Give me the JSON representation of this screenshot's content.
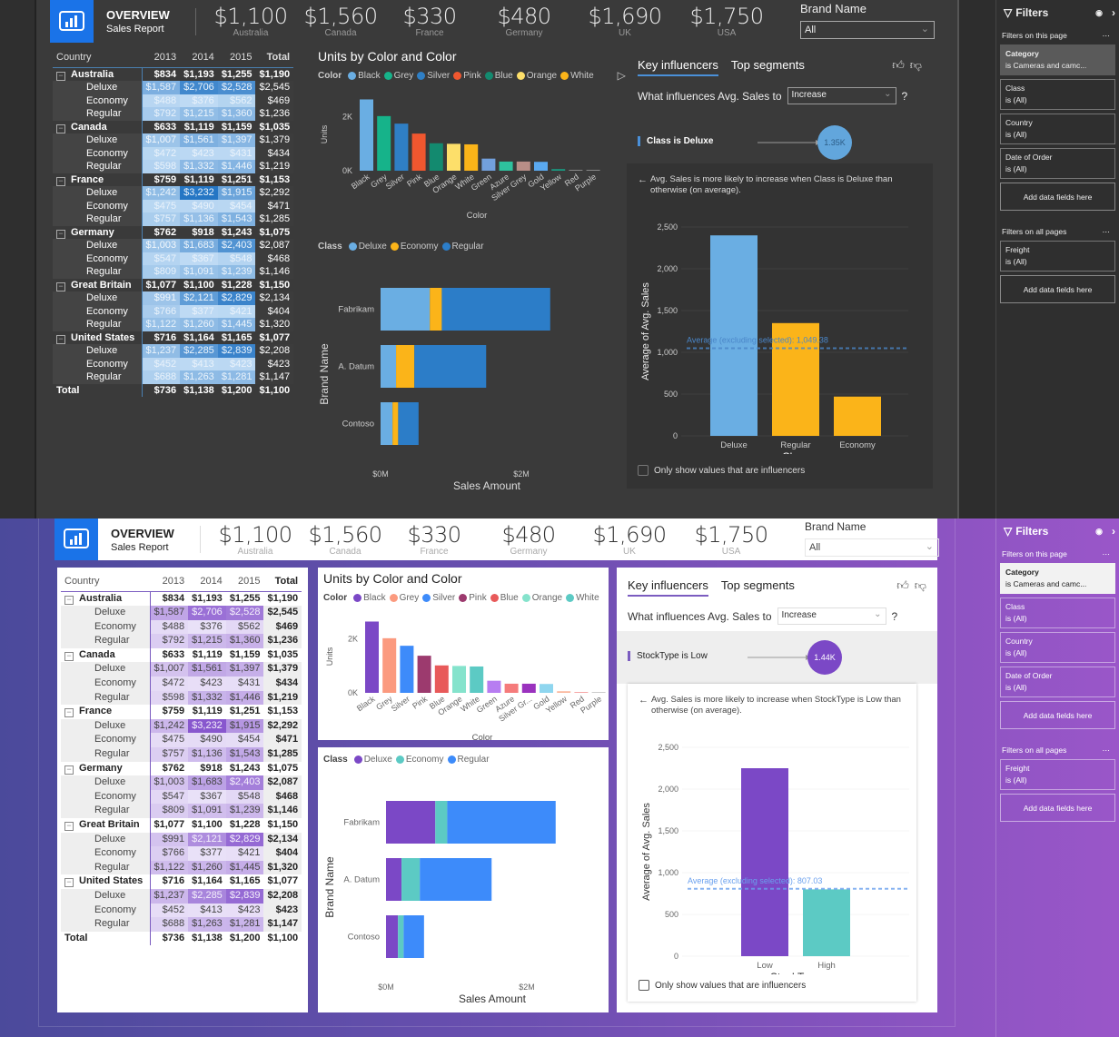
{
  "themes": [
    {
      "id": "dark",
      "header": {
        "title": "OVERVIEW",
        "subtitle": "Sales Report",
        "kpis": [
          {
            "value": "$1,100",
            "label": "Australia"
          },
          {
            "value": "$1,560",
            "label": "Canada"
          },
          {
            "value": "$330",
            "label": "France"
          },
          {
            "value": "$480",
            "label": "Germany"
          },
          {
            "value": "$1,690",
            "label": "UK"
          },
          {
            "value": "$1,750",
            "label": "USA"
          }
        ],
        "slicer": {
          "label": "Brand Name",
          "value": "All"
        }
      },
      "colors": {
        "units_bars": [
          "#6aaee3",
          "#16b38a",
          "#2f7fc5",
          "#f0572f",
          "#138a6f",
          "#fddf6a",
          "#fbb419",
          "#72a0dd",
          "#2ec29e",
          "#b88e87",
          "#5aa9f0",
          "#1a9b82",
          "#888888",
          "#888888"
        ],
        "class": {
          "Deluxe": "#6aaee3",
          "Economy": "#fbb419",
          "Regular": "#2c7dc8"
        },
        "ki_bars": [
          "#6aaee3",
          "#fbb419",
          "#fbb419"
        ],
        "ki_avg_line": "#4a86c8",
        "heat_low": [
          191,
          219,
          244
        ],
        "heat_high": [
          36,
          117,
          196
        ]
      },
      "key_influencers": {
        "factor": "Class is Deluxe",
        "bubble": "1.35K",
        "description": "Avg. Sales is more likely to increase when Class is Deluxe than otherwise (on average).",
        "xlabel": "Class",
        "categories": [
          "Deluxe",
          "Regular",
          "Economy"
        ],
        "values": [
          2400,
          1350,
          470
        ],
        "average_label": "Average (excluding selected): 1,049.38",
        "average": 1049.38
      }
    },
    {
      "id": "light",
      "header": {
        "title": "OVERVIEW",
        "subtitle": "Sales Report",
        "kpis": [
          {
            "value": "$1,100",
            "label": "Australia"
          },
          {
            "value": "$1,560",
            "label": "Canada"
          },
          {
            "value": "$330",
            "label": "France"
          },
          {
            "value": "$480",
            "label": "Germany"
          },
          {
            "value": "$1,690",
            "label": "UK"
          },
          {
            "value": "$1,750",
            "label": "USA"
          }
        ],
        "slicer": {
          "label": "Brand Name",
          "value": "All"
        }
      },
      "colors": {
        "units_bars": [
          "#7b48c6",
          "#fb9a7f",
          "#3d8bfa",
          "#9c3a6e",
          "#e85a5a",
          "#85e3cc",
          "#5ccac4",
          "#b77df1",
          "#f57b7b",
          "#9a32be",
          "#8fd6ef",
          "#fbb99f",
          "#f6a6a6",
          "#cccccc"
        ],
        "class": {
          "Deluxe": "#7b48c6",
          "Economy": "#5ccac4",
          "Regular": "#3d8bfa"
        },
        "ki_bars": [
          "#7b48c6",
          "#5ccac4"
        ],
        "ki_avg_line": "#6aa0ee",
        "heat_low": [
          234,
          226,
          248
        ],
        "heat_high": [
          135,
          86,
          206
        ]
      },
      "key_influencers": {
        "factor": "StockType is Low",
        "bubble": "1.44K",
        "description": "Avg. Sales is more likely to increase when StockType is Low than otherwise (on average).",
        "xlabel": "StockType",
        "categories": [
          "Low",
          "High"
        ],
        "values": [
          2250,
          800
        ],
        "average_label": "Average (excluding selected): 807.03",
        "average": 807.03
      }
    }
  ],
  "matrix": {
    "headers": [
      "Country",
      "2013",
      "2014",
      "2015",
      "Total"
    ],
    "rows": [
      {
        "type": "country",
        "name": "Australia",
        "v": [
          "$834",
          "$1,193",
          "$1,255",
          "$1,190"
        ]
      },
      {
        "type": "sub",
        "name": "Deluxe",
        "v": [
          "$1,587",
          "$2,706",
          "$2,528",
          "$2,545"
        ],
        "n": [
          1587,
          2706,
          2528
        ]
      },
      {
        "type": "sub",
        "name": "Economy",
        "v": [
          "$488",
          "$376",
          "$562",
          "$469"
        ],
        "n": [
          488,
          376,
          562
        ]
      },
      {
        "type": "sub",
        "name": "Regular",
        "v": [
          "$792",
          "$1,215",
          "$1,360",
          "$1,236"
        ],
        "n": [
          792,
          1215,
          1360
        ]
      },
      {
        "type": "country",
        "name": "Canada",
        "v": [
          "$633",
          "$1,119",
          "$1,159",
          "$1,035"
        ]
      },
      {
        "type": "sub",
        "name": "Deluxe",
        "v": [
          "$1,007",
          "$1,561",
          "$1,397",
          "$1,379"
        ],
        "n": [
          1007,
          1561,
          1397
        ]
      },
      {
        "type": "sub",
        "name": "Economy",
        "v": [
          "$472",
          "$423",
          "$431",
          "$434"
        ],
        "n": [
          472,
          423,
          431
        ]
      },
      {
        "type": "sub",
        "name": "Regular",
        "v": [
          "$598",
          "$1,332",
          "$1,446",
          "$1,219"
        ],
        "n": [
          598,
          1332,
          1446
        ]
      },
      {
        "type": "country",
        "name": "France",
        "v": [
          "$759",
          "$1,119",
          "$1,251",
          "$1,153"
        ]
      },
      {
        "type": "sub",
        "name": "Deluxe",
        "v": [
          "$1,242",
          "$3,232",
          "$1,915",
          "$2,292"
        ],
        "n": [
          1242,
          3232,
          1915
        ]
      },
      {
        "type": "sub",
        "name": "Economy",
        "v": [
          "$475",
          "$490",
          "$454",
          "$471"
        ],
        "n": [
          475,
          490,
          454
        ]
      },
      {
        "type": "sub",
        "name": "Regular",
        "v": [
          "$757",
          "$1,136",
          "$1,543",
          "$1,285"
        ],
        "n": [
          757,
          1136,
          1543
        ]
      },
      {
        "type": "country",
        "name": "Germany",
        "v": [
          "$762",
          "$918",
          "$1,243",
          "$1,075"
        ]
      },
      {
        "type": "sub",
        "name": "Deluxe",
        "v": [
          "$1,003",
          "$1,683",
          "$2,403",
          "$2,087"
        ],
        "n": [
          1003,
          1683,
          2403
        ]
      },
      {
        "type": "sub",
        "name": "Economy",
        "v": [
          "$547",
          "$367",
          "$548",
          "$468"
        ],
        "n": [
          547,
          367,
          548
        ]
      },
      {
        "type": "sub",
        "name": "Regular",
        "v": [
          "$809",
          "$1,091",
          "$1,239",
          "$1,146"
        ],
        "n": [
          809,
          1091,
          1239
        ]
      },
      {
        "type": "country",
        "name": "Great Britain",
        "v": [
          "$1,077",
          "$1,100",
          "$1,228",
          "$1,150"
        ]
      },
      {
        "type": "sub",
        "name": "Deluxe",
        "v": [
          "$991",
          "$2,121",
          "$2,829",
          "$2,134"
        ],
        "n": [
          991,
          2121,
          2829
        ]
      },
      {
        "type": "sub",
        "name": "Economy",
        "v": [
          "$766",
          "$377",
          "$421",
          "$404"
        ],
        "n": [
          766,
          377,
          421
        ]
      },
      {
        "type": "sub",
        "name": "Regular",
        "v": [
          "$1,122",
          "$1,260",
          "$1,445",
          "$1,320"
        ],
        "n": [
          1122,
          1260,
          1445
        ]
      },
      {
        "type": "country",
        "name": "United States",
        "v": [
          "$716",
          "$1,164",
          "$1,165",
          "$1,077"
        ]
      },
      {
        "type": "sub",
        "name": "Deluxe",
        "v": [
          "$1,237",
          "$2,285",
          "$2,839",
          "$2,208"
        ],
        "n": [
          1237,
          2285,
          2839
        ]
      },
      {
        "type": "sub",
        "name": "Economy",
        "v": [
          "$452",
          "$413",
          "$423",
          "$423"
        ],
        "n": [
          452,
          413,
          423
        ]
      },
      {
        "type": "sub",
        "name": "Regular",
        "v": [
          "$688",
          "$1,263",
          "$1,281",
          "$1,147"
        ],
        "n": [
          688,
          1263,
          1281
        ]
      },
      {
        "type": "total",
        "name": "Total",
        "v": [
          "$736",
          "$1,138",
          "$1,200",
          "$1,100"
        ]
      }
    ]
  },
  "units_chart": {
    "title": "Units by Color and Color",
    "legend_title": "Color",
    "legend_items": [
      "Black",
      "Grey",
      "Silver",
      "Pink",
      "Blue",
      "Orange",
      "White"
    ],
    "xlabel": "Color",
    "ylabel": "Units",
    "yticks": [
      "0K",
      "2K"
    ],
    "categories_dark": [
      "Black",
      "Grey",
      "Silver",
      "Pink",
      "Blue",
      "Orange",
      "White",
      "Green",
      "Azure",
      "Silver Grey",
      "Gold",
      "Yellow",
      "Red",
      "Purple"
    ],
    "categories_light": [
      "Black",
      "Grey",
      "Silver",
      "Pink",
      "Blue",
      "Orange",
      "White",
      "Green",
      "Azure",
      "Silver Gr...",
      "Gold",
      "Yellow",
      "Red",
      "Purple"
    ],
    "values": [
      2650,
      2030,
      1750,
      1380,
      1020,
      1000,
      980,
      450,
      340,
      340,
      330,
      60,
      20,
      10
    ]
  },
  "brand_chart": {
    "legend_title": "Class",
    "legend_items": [
      "Deluxe",
      "Economy",
      "Regular"
    ],
    "xlabel": "Sales Amount",
    "ylabel": "Brand Name",
    "xticks": [
      "$0M",
      "$2M"
    ],
    "brands": [
      "Fabrikam",
      "A. Datum",
      "Contoso"
    ],
    "series": [
      {
        "name": "Deluxe",
        "values": [
          0.7,
          0.22,
          0.17
        ]
      },
      {
        "name": "Economy",
        "values": [
          0.17,
          0.26,
          0.08
        ]
      },
      {
        "name": "Regular",
        "values": [
          1.54,
          1.02,
          0.29
        ]
      }
    ]
  },
  "ki_common": {
    "tab_active": "Key influencers",
    "tab_other": "Top segments",
    "question": "What influences Avg. Sales to",
    "select_value": "Increase",
    "help": "?",
    "ylabel": "Average of Avg. Sales",
    "yticks": [
      "0",
      "500",
      "1,000",
      "1,500",
      "2,000",
      "2,500"
    ],
    "checkbox_label": "Only show values that are influencers"
  },
  "filters": {
    "title": "Filters",
    "section_page": "Filters on this page",
    "section_all": "Filters on all pages",
    "page_filters": [
      {
        "name": "Category",
        "value": "is Cameras and camc..."
      },
      {
        "name": "Class",
        "value": "is (All)"
      },
      {
        "name": "Country",
        "value": "is (All)"
      },
      {
        "name": "Date of Order",
        "value": "is (All)"
      }
    ],
    "all_filters": [
      {
        "name": "Freight",
        "value": "is (All)"
      }
    ],
    "add_label": "Add data fields here"
  }
}
